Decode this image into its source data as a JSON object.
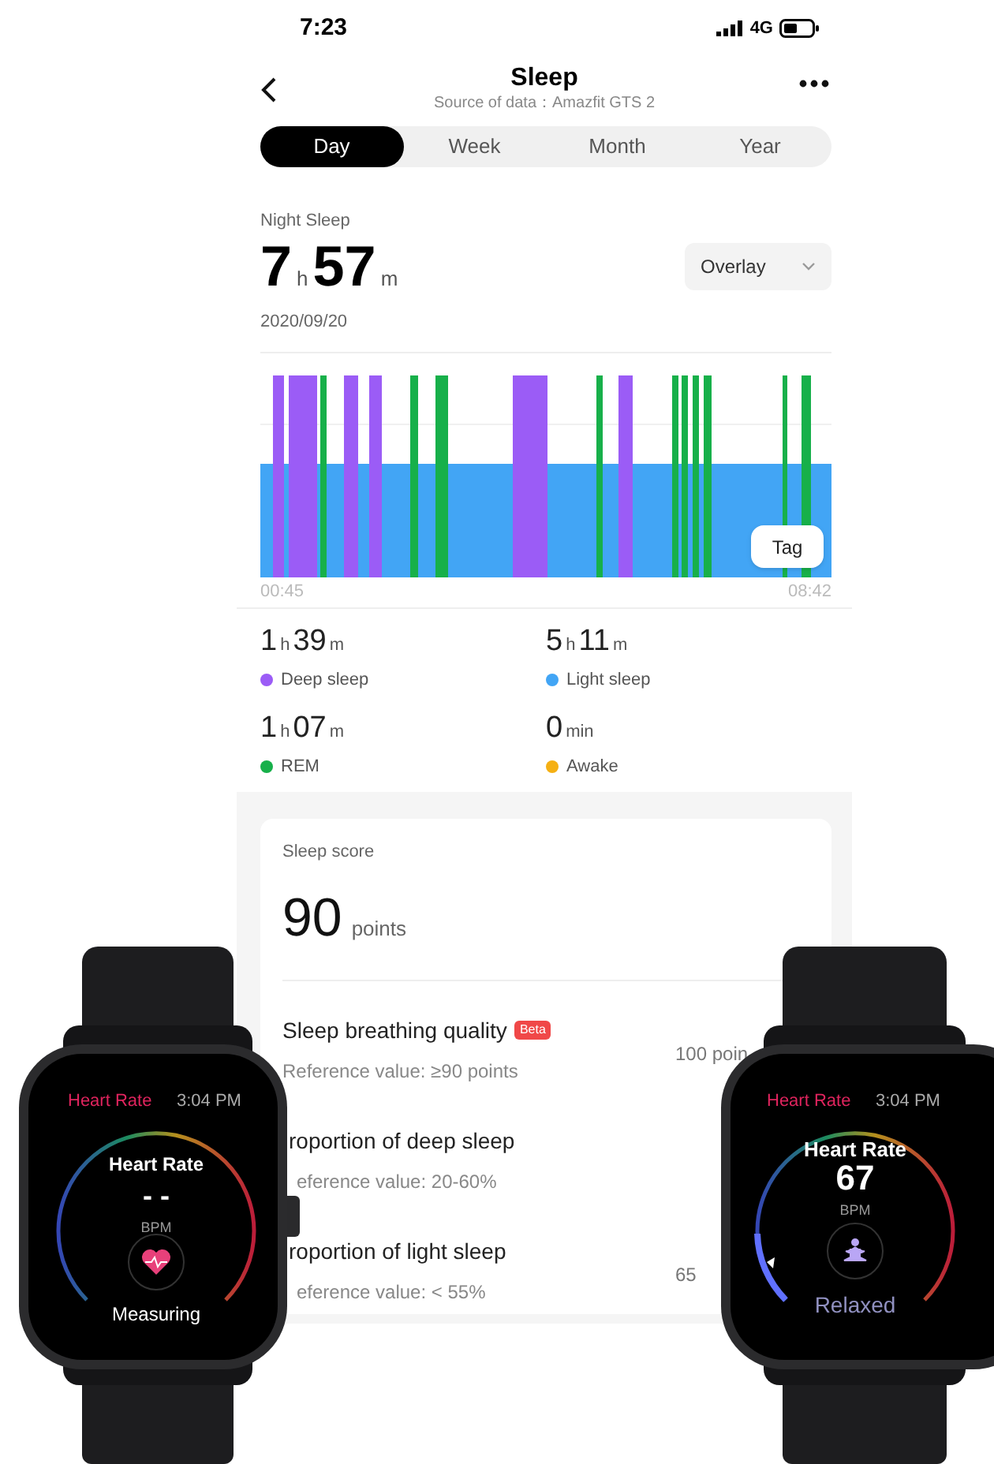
{
  "status_bar": {
    "time": "7:23",
    "network": "4G"
  },
  "header": {
    "title": "Sleep",
    "subtitle": "Source of data：Amazfit GTS 2"
  },
  "tabs": [
    {
      "label": "Day",
      "selected": true
    },
    {
      "label": "Week",
      "selected": false
    },
    {
      "label": "Month",
      "selected": false
    },
    {
      "label": "Year",
      "selected": false
    }
  ],
  "night_sleep": {
    "label": "Night Sleep",
    "duration": [
      {
        "n": "7",
        "u": "h"
      },
      {
        "n": "57",
        "u": "m"
      }
    ],
    "date": "2020/09/20",
    "view_select": "Overlay"
  },
  "chart": {
    "start_time": "00:45",
    "end_time": "08:42",
    "tag_button": "Tag"
  },
  "stages": [
    {
      "duration": [
        {
          "n": "1",
          "u": "h"
        },
        {
          "n": "39",
          "u": "m"
        }
      ],
      "label": "Deep sleep",
      "color": "#9b5cf6"
    },
    {
      "duration": [
        {
          "n": "5",
          "u": "h"
        },
        {
          "n": "11",
          "u": "m"
        }
      ],
      "label": "Light sleep",
      "color": "#42a5f5"
    },
    {
      "duration": [
        {
          "n": "1",
          "u": "h"
        },
        {
          "n": "07",
          "u": "m"
        }
      ],
      "label": "REM",
      "color": "#17b04a"
    },
    {
      "duration": [
        {
          "n": "0",
          "u": "min"
        }
      ],
      "label": "Awake",
      "color": "#f5b014"
    }
  ],
  "score": {
    "title": "Sleep score",
    "value": "90",
    "unit": "points"
  },
  "metrics": [
    {
      "name": "Sleep breathing quality",
      "badge": "Beta",
      "reference": "Reference value: ≥90 points",
      "value": "100 poin"
    },
    {
      "name": "roportion of deep sleep",
      "reference": "eference value: 20-60%"
    },
    {
      "name": "roportion of light sleep",
      "reference": "eference value: < 55%",
      "value": "65"
    }
  ],
  "watches": [
    {
      "kind": "measuring",
      "app": "Heart Rate",
      "time": "3:04 PM",
      "title": "Heart Rate",
      "reading": "- -",
      "unit": "BPM",
      "status": "Measuring"
    },
    {
      "kind": "relaxed",
      "app": "Heart Rate",
      "time": "3:04 PM",
      "title": "Heart Rate",
      "reading": "67",
      "unit": "BPM",
      "status": "Relaxed"
    }
  ]
}
